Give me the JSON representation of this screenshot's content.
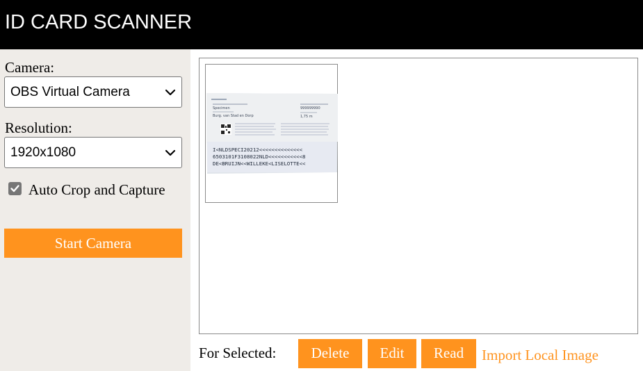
{
  "header": {
    "title": "ID CARD SCANNER"
  },
  "sidebar": {
    "camera": {
      "label": "Camera:",
      "selected": "OBS Virtual Camera"
    },
    "resolution": {
      "label": "Resolution:",
      "selected": "1920x1080"
    },
    "auto_crop": {
      "label": "Auto Crop and Capture",
      "checked": true
    },
    "start_button": "Start Camera"
  },
  "gallery": {
    "items": [
      {
        "type": "id-card-back",
        "card_text": {
          "name": "Specimen",
          "place": "Burg. van Stad en Dorp",
          "doc_number": "999999990",
          "height": "1,75 m",
          "mrz": [
            "I<NLDSPECI20212<<<<<<<<<<<<<<",
            "6503101F3108022NLD<<<<<<<<<<<8",
            "DE<BRUIJN<<WILLEKE<LISELOTTE<<"
          ]
        }
      }
    ]
  },
  "actions": {
    "label": "For Selected:",
    "delete": "Delete",
    "edit": "Edit",
    "read": "Read",
    "import": "Import Local Image"
  },
  "colors": {
    "accent": "#ff931e",
    "header_bg": "#000000",
    "sidebar_bg": "#efece8"
  }
}
